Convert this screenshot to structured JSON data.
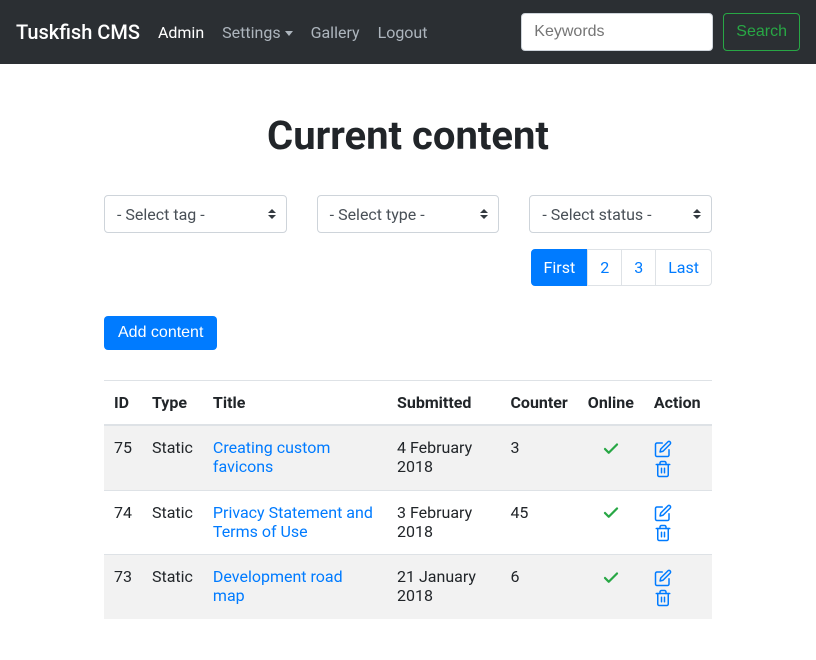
{
  "navbar": {
    "brand": "Tuskfish CMS",
    "links": {
      "admin": "Admin",
      "settings": "Settings",
      "gallery": "Gallery",
      "logout": "Logout"
    },
    "search_placeholder": "Keywords",
    "search_button": "Search"
  },
  "page": {
    "title": "Current content",
    "add_button": "Add content"
  },
  "filters": {
    "tag": "- Select tag -",
    "type": "- Select type -",
    "status": "- Select status -"
  },
  "pagination": {
    "first": "First",
    "p2": "2",
    "p3": "3",
    "last": "Last"
  },
  "table": {
    "headers": {
      "id": "ID",
      "type": "Type",
      "title": "Title",
      "submitted": "Submitted",
      "counter": "Counter",
      "online": "Online",
      "action": "Action"
    },
    "rows": [
      {
        "id": "75",
        "type": "Static",
        "title": "Creating custom favicons",
        "submitted": "4 February 2018",
        "counter": "3"
      },
      {
        "id": "74",
        "type": "Static",
        "title": "Privacy Statement and Terms of Use",
        "submitted": "3 February 2018",
        "counter": "45"
      },
      {
        "id": "73",
        "type": "Static",
        "title": "Development road map",
        "submitted": "21 January 2018",
        "counter": "6"
      }
    ]
  }
}
